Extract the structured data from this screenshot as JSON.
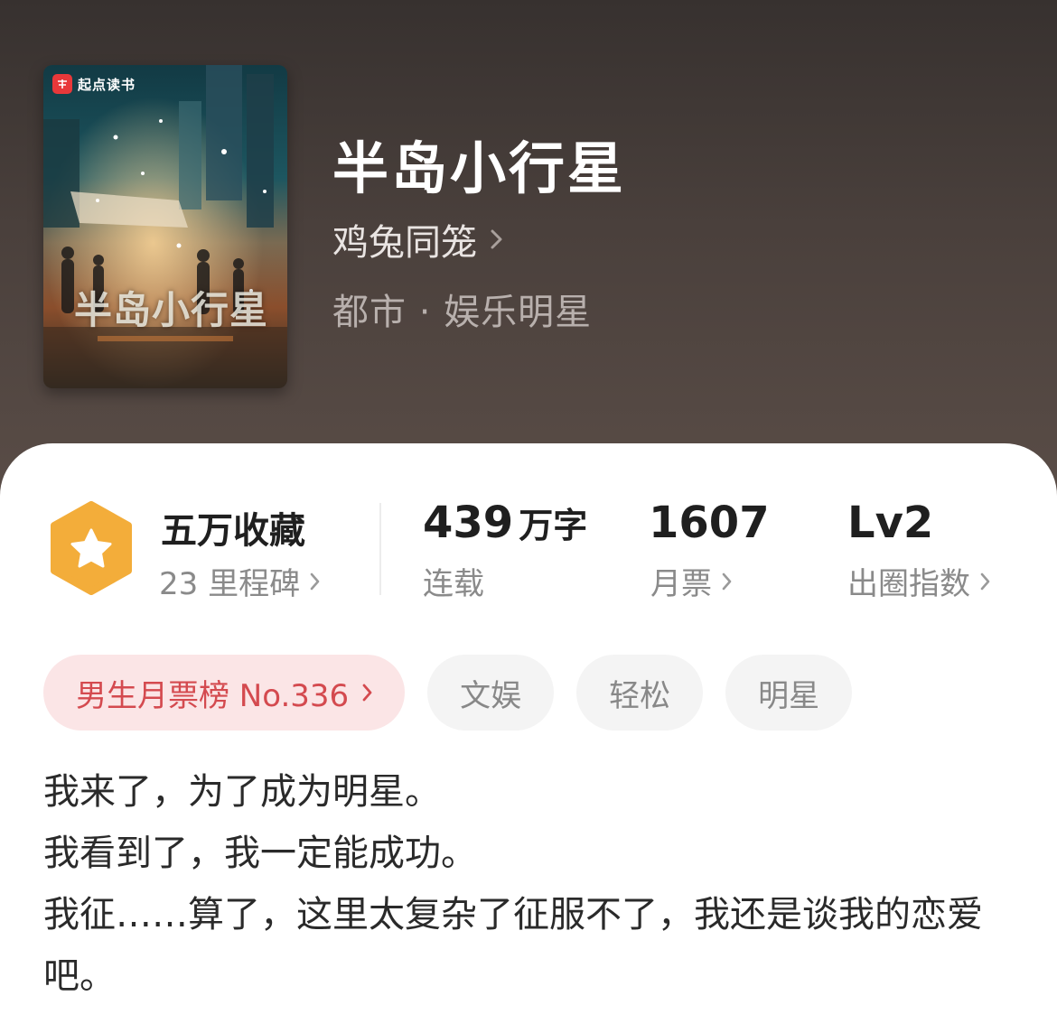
{
  "book": {
    "cover_brand": "起点读书",
    "cover_brand_logo": "起点",
    "cover_title": "半岛小行星",
    "title": "半岛小行星",
    "author": "鸡兔同笼",
    "genre": "都市 · 娱乐明星"
  },
  "stats": {
    "collection": {
      "value": "五万收藏",
      "sub": "23 里程碑",
      "icon": "star-badge-icon"
    },
    "words": {
      "number": "439",
      "unit": "万字",
      "sub": "连载"
    },
    "monthly_tickets": {
      "value": "1607",
      "sub": "月票"
    },
    "influence": {
      "value": "Lv2",
      "sub": "出圈指数"
    }
  },
  "tags": {
    "rank": "男生月票榜 No.336",
    "items": [
      "文娱",
      "轻松",
      "明星"
    ]
  },
  "description": [
    "我来了，为了成为明星。",
    "我看到了，我一定能成功。",
    "我征……算了，这里太复杂了征服不了，我还是谈我的恋爱吧。"
  ],
  "colors": {
    "accent_red": "#d44a4f",
    "badge_gold": "#f3ad3a",
    "header_bg": "#3f3734"
  }
}
